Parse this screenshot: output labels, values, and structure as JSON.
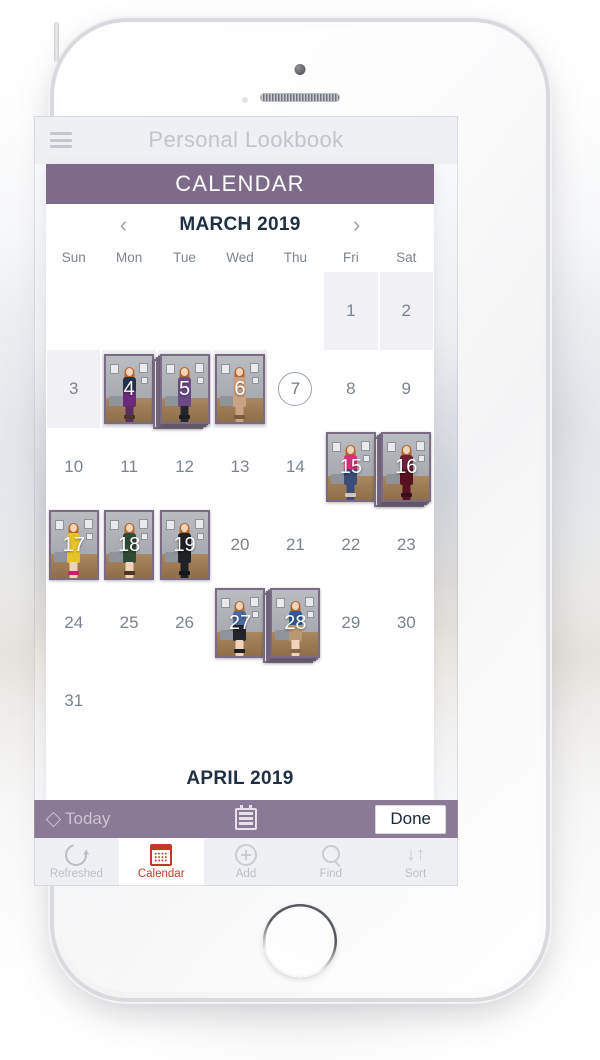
{
  "app": {
    "title": "Personal Lookbook",
    "menu_icon": "hamburger-icon"
  },
  "modal": {
    "header_title": "CALENDAR",
    "prev_arrow": "‹",
    "next_arrow": "›",
    "month_label": "MARCH 2019",
    "next_month_label": "APRIL 2019",
    "weekdays": [
      "Sun",
      "Mon",
      "Tue",
      "Wed",
      "Thu",
      "Fri",
      "Sat"
    ],
    "today_day": 7,
    "weeks": [
      [
        {
          "day": "",
          "tint": false,
          "photos": 0
        },
        {
          "day": "",
          "tint": false,
          "photos": 0
        },
        {
          "day": "",
          "tint": false,
          "photos": 0
        },
        {
          "day": "",
          "tint": false,
          "photos": 0
        },
        {
          "day": "",
          "tint": false,
          "photos": 0
        },
        {
          "day": "1",
          "tint": true,
          "photos": 0
        },
        {
          "day": "2",
          "tint": true,
          "photos": 0
        }
      ],
      [
        {
          "day": "3",
          "tint": true,
          "photos": 0
        },
        {
          "day": "4",
          "tint": true,
          "photos": 1,
          "outfit": "navy-top-purple-skirt"
        },
        {
          "day": "5",
          "tint": true,
          "photos": 3,
          "outfit": "purple-top-black-pants"
        },
        {
          "day": "6",
          "tint": true,
          "photos": 1,
          "outfit": "tan-dress"
        },
        {
          "day": "7",
          "tint": false,
          "photos": 0,
          "today": true
        },
        {
          "day": "8",
          "tint": false,
          "photos": 0
        },
        {
          "day": "9",
          "tint": false,
          "photos": 0
        }
      ],
      [
        {
          "day": "10",
          "tint": false,
          "photos": 0
        },
        {
          "day": "11",
          "tint": false,
          "photos": 0
        },
        {
          "day": "12",
          "tint": false,
          "photos": 0
        },
        {
          "day": "13",
          "tint": false,
          "photos": 0
        },
        {
          "day": "14",
          "tint": false,
          "photos": 0
        },
        {
          "day": "15",
          "tint": false,
          "photos": 1,
          "outfit": "pink-top-jeans"
        },
        {
          "day": "16",
          "tint": false,
          "photos": 3,
          "outfit": "maroon-maxi-skirt"
        }
      ],
      [
        {
          "day": "17",
          "tint": false,
          "photos": 1,
          "outfit": "yellow-dress"
        },
        {
          "day": "18",
          "tint": false,
          "photos": 1,
          "outfit": "green-dress"
        },
        {
          "day": "19",
          "tint": false,
          "photos": 1,
          "outfit": "black-jumpsuit"
        },
        {
          "day": "20",
          "tint": false,
          "photos": 0
        },
        {
          "day": "21",
          "tint": false,
          "photos": 0
        },
        {
          "day": "22",
          "tint": false,
          "photos": 0
        },
        {
          "day": "23",
          "tint": false,
          "photos": 0
        }
      ],
      [
        {
          "day": "24",
          "tint": false,
          "photos": 0
        },
        {
          "day": "25",
          "tint": false,
          "photos": 0
        },
        {
          "day": "26",
          "tint": false,
          "photos": 0
        },
        {
          "day": "27",
          "tint": false,
          "photos": 1,
          "outfit": "denim-top-black-skirt"
        },
        {
          "day": "28",
          "tint": false,
          "photos": 3,
          "outfit": "blue-top-tan-skirt"
        },
        {
          "day": "29",
          "tint": false,
          "photos": 0
        },
        {
          "day": "30",
          "tint": false,
          "photos": 0
        }
      ],
      [
        {
          "day": "31",
          "tint": false,
          "photos": 0
        },
        {
          "day": "",
          "tint": false,
          "photos": 0
        },
        {
          "day": "",
          "tint": false,
          "photos": 0
        },
        {
          "day": "",
          "tint": false,
          "photos": 0
        },
        {
          "day": "",
          "tint": false,
          "photos": 0
        },
        {
          "day": "",
          "tint": false,
          "photos": 0
        },
        {
          "day": "",
          "tint": false,
          "photos": 0
        }
      ]
    ]
  },
  "toolbar": {
    "today_label": "Today",
    "today_icon": "diamond-icon",
    "list_icon": "calendar-list-icon",
    "done_label": "Done"
  },
  "tabbar": {
    "items": [
      {
        "label": "Refreshed",
        "icon": "refresh-icon",
        "active": false
      },
      {
        "label": "Calendar",
        "icon": "calendar-icon",
        "active": true
      },
      {
        "label": "Add",
        "icon": "plus-circle-icon",
        "active": false
      },
      {
        "label": "Find",
        "icon": "search-icon",
        "active": false
      },
      {
        "label": "Sort",
        "icon": "sort-arrows-icon",
        "active": false
      }
    ]
  },
  "colors": {
    "header_purple": "#7e6b8a",
    "toolbar_purple": "#8a7a95",
    "accent_red": "#c0392b",
    "cell_tint": "#f1f0f5",
    "month_text": "#1f3043"
  }
}
